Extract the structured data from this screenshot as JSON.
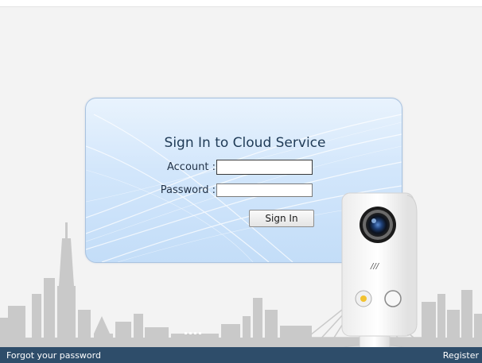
{
  "login": {
    "title": "Sign In to Cloud Service",
    "account_label": "Account :",
    "password_label": "Password :",
    "account_value": "",
    "password_value": "",
    "submit_label": "Sign In"
  },
  "footer": {
    "forgot_label": "Forgot your password",
    "register_label": "Register"
  },
  "colors": {
    "footer_bg": "#2e4d6a",
    "panel_bg": "#d2e6fb",
    "skyline": "#c4c4c4"
  },
  "icons": {
    "camera": "cloud-camera-icon",
    "skyline": "city-skyline-icon"
  }
}
